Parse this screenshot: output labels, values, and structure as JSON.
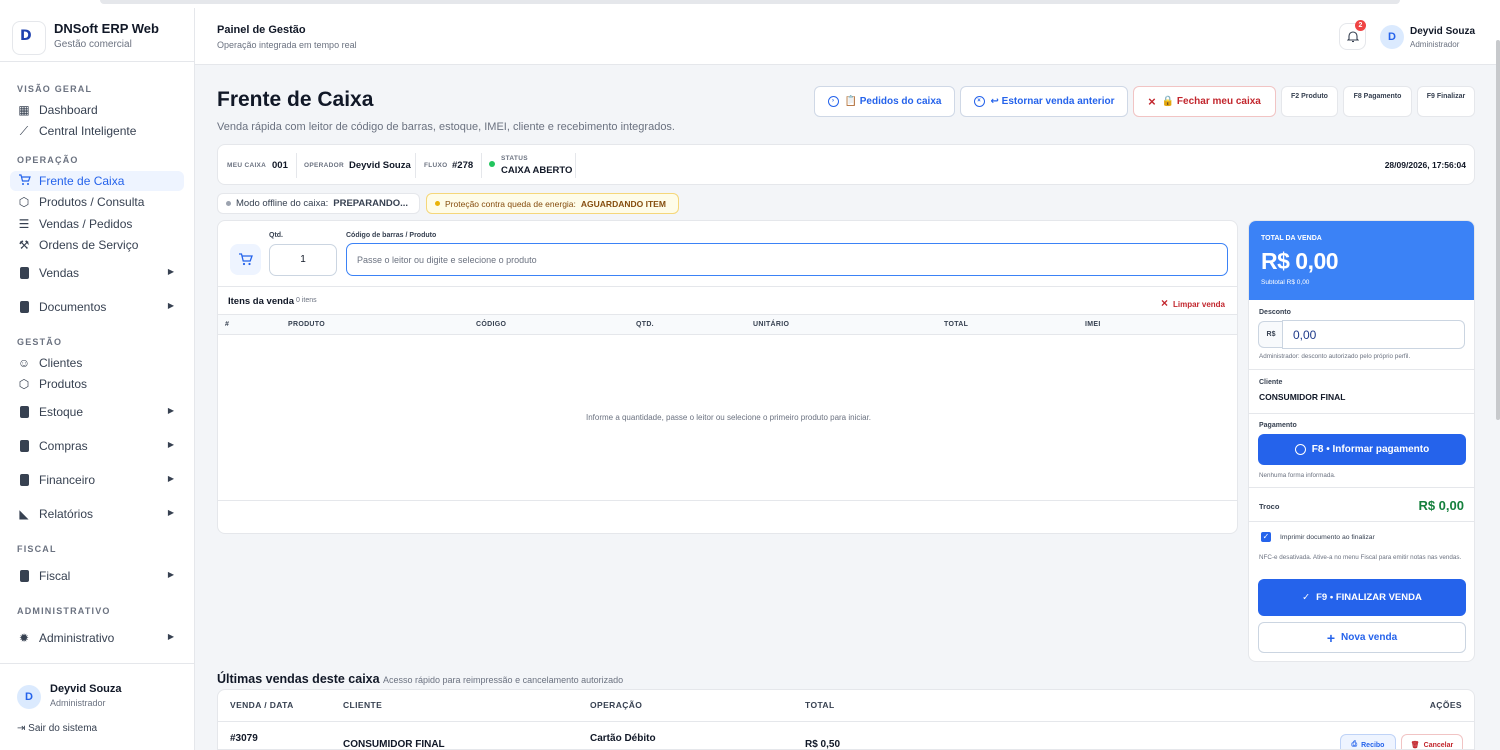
{
  "brand": {
    "name": "DNSoft ERP Web",
    "subtitle": "Gestão comercial",
    "logo": "D"
  },
  "sidebar": {
    "sections": {
      "overview": "VISÃO GERAL",
      "operation": "OPERAÇÃO",
      "management": "GESTÃO",
      "fiscal": "FISCAL",
      "admin": "ADMINISTRATIVO"
    },
    "items": {
      "dashboard": "Dashboard",
      "central": "Central Inteligente",
      "frente": "Frente de Caixa",
      "produtos_consulta": "Produtos / Consulta",
      "vendas_pedidos": "Vendas / Pedidos",
      "ordens": "Ordens de Serviço",
      "vendas": "Vendas",
      "documentos": "Documentos",
      "clientes": "Clientes",
      "produtos": "Produtos",
      "estoque": "Estoque",
      "compras": "Compras",
      "financeiro": "Financeiro",
      "relatorios": "Relatórios",
      "fiscal": "Fiscal",
      "administrativo": "Administrativo"
    },
    "user": {
      "initial": "D",
      "name": "Deyvid Souza",
      "role": "Administrador"
    },
    "logout": "Sair do sistema"
  },
  "header": {
    "title": "Painel de Gestão",
    "subtitle": "Operação integrada em tempo real",
    "notifications": "2",
    "user": {
      "initial": "D",
      "name": "Deyvid Souza",
      "role": "Administrador"
    }
  },
  "page": {
    "title": "Frente de Caixa",
    "subtitle": "Venda rápida com leitor de código de barras, estoque, IMEI, cliente e recebimento integrados.",
    "buttons": {
      "pedidos": "📋 Pedidos do caixa",
      "estornar": "↩ Estornar venda anterior",
      "fechar": "🔒 Fechar meu caixa",
      "f2": "F2 Produto",
      "f8": "F8 Pagamento",
      "f9": "F9 Finalizar"
    }
  },
  "info": {
    "meu_caixa_label": "MEU CAIXA",
    "meu_caixa": "001",
    "operador_label": "OPERADOR",
    "operador": "Deyvid Souza",
    "fluxo_label": "FLUXO",
    "fluxo": "#278",
    "status_label": "STATUS",
    "status": "CAIXA ABERTO",
    "datetime": "28/09/2026, 17:56:04"
  },
  "pills": {
    "offline_prefix": "Modo offline do caixa:",
    "offline_value": "PREPARANDO...",
    "energy_prefix": "Proteção contra queda de energia:",
    "energy_value": "AGUARDANDO ITEM"
  },
  "entry": {
    "qty_label": "Qtd.",
    "qty_value": "1",
    "barcode_label": "Código de barras / Produto",
    "barcode_placeholder": "Passe o leitor ou digite e selecione o produto"
  },
  "items": {
    "title": "Itens da venda",
    "count": "0 itens",
    "clear": "Limpar venda",
    "columns": [
      "#",
      "PRODUTO",
      "CÓDIGO",
      "QTD.",
      "UNITÁRIO",
      "TOTAL",
      "IMEI"
    ],
    "empty": "Informe a quantidade, passe o leitor ou selecione o primeiro produto para iniciar."
  },
  "summary": {
    "total_label": "TOTAL DA VENDA",
    "total": "R$ 0,00",
    "subtotal": "Subtotal R$ 0,00",
    "discount_label": "Desconto",
    "currency": "R$",
    "discount": "0,00",
    "discount_note": "Administrador: desconto autorizado pelo próprio perfil.",
    "client_label": "Cliente",
    "client": "CONSUMIDOR FINAL",
    "payment_label": "Pagamento",
    "payment_button": "F8 • Informar pagamento",
    "payment_note": "Nenhuma forma informada.",
    "change_label": "Troco",
    "change": "R$ 0,00",
    "print_label": "Imprimir documento ao finalizar",
    "nfce_note": "NFC-e desativada. Ative-a no menu Fiscal para emitir notas nas vendas.",
    "finish_button": "F9 • FINALIZAR VENDA",
    "new_button": "Nova venda"
  },
  "recent": {
    "title": "Últimas vendas deste caixa",
    "subtitle": "Acesso rápido para reimpressão e cancelamento autorizado",
    "columns": {
      "venda": "VENDA / DATA",
      "cliente": "CLIENTE",
      "operacao": "OPERAÇÃO",
      "total": "TOTAL",
      "acoes": "AÇÕES"
    },
    "row": {
      "venda": "#3079",
      "cliente": "CONSUMIDOR FINAL",
      "operacao": "Cartão Débito",
      "total": "R$ 0,50",
      "recibo": "Recibo",
      "cancelar": "Cancelar"
    }
  },
  "colors": {
    "accent": "#2563eb",
    "danger": "#c2262d",
    "success": "#15803d",
    "total_bg": "#3b82f6"
  }
}
